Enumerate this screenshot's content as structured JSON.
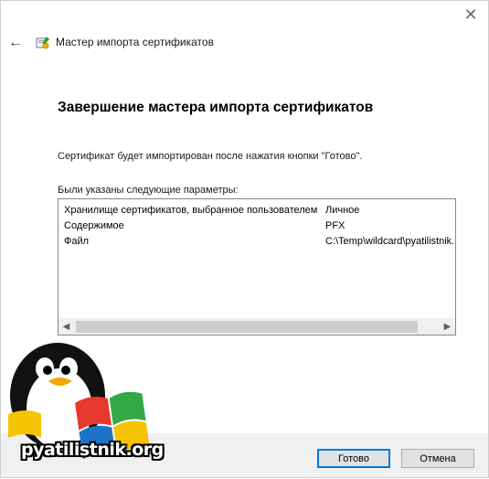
{
  "window": {
    "close_glyph": "✕",
    "back_glyph": "←"
  },
  "header": {
    "title": "Мастер импорта сертификатов",
    "icon": "certificate-wizard-icon"
  },
  "main": {
    "heading": "Завершение мастера импорта сертификатов",
    "info": "Сертификат будет импортирован после нажатия кнопки \"Готово\".",
    "params_label": "Были указаны следующие параметры:",
    "params": [
      {
        "key": "Хранилище сертификатов, выбранное пользователем",
        "value": "Личное"
      },
      {
        "key": "Содержимое",
        "value": "PFX"
      },
      {
        "key": "Файл",
        "value": "C:\\Temp\\wildcard\\pyatilistnik."
      }
    ]
  },
  "footer": {
    "finish_label": "Готово",
    "cancel_label": "Отмена"
  },
  "watermark": {
    "text": "pyatilistnik.org"
  },
  "colors": {
    "accent": "#0078d7",
    "footer_bg": "#f0f0f0"
  }
}
